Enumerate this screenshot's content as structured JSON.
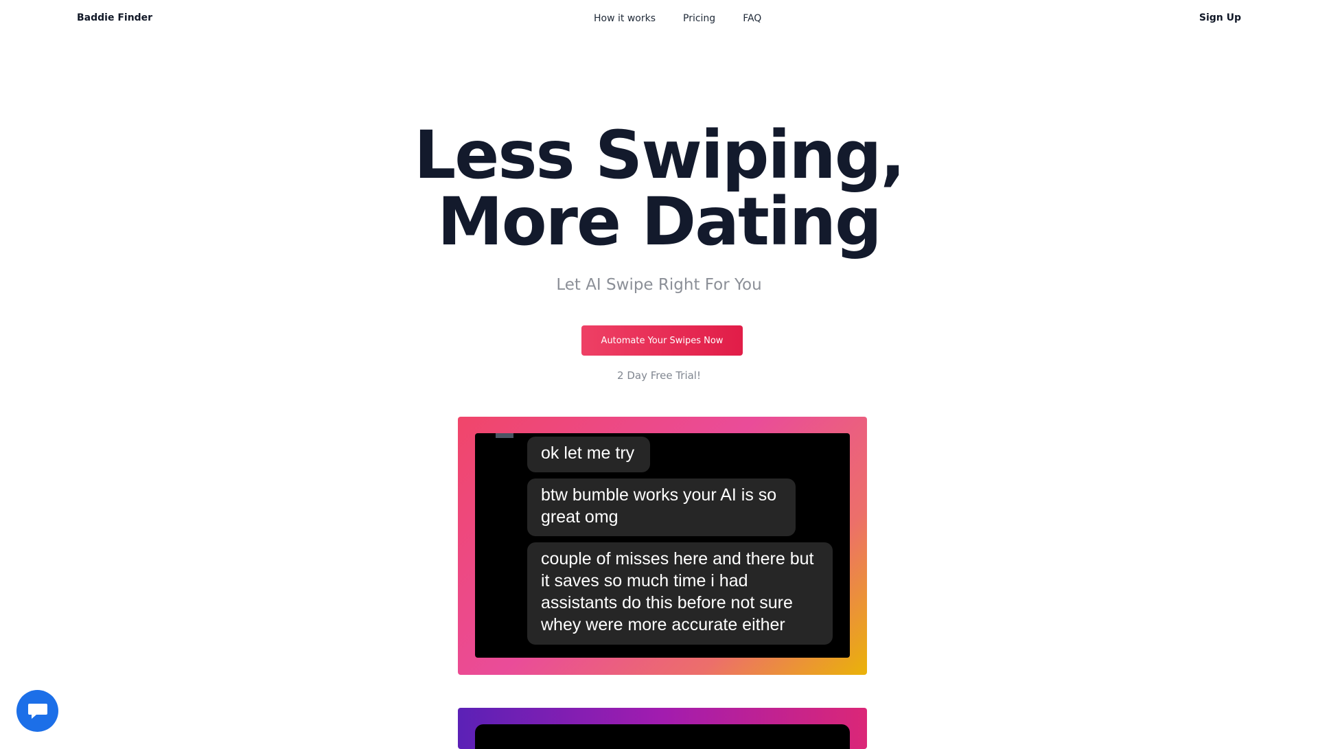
{
  "nav": {
    "brand": "Baddie Finder",
    "links": [
      "How it works",
      "Pricing",
      "FAQ"
    ],
    "signup": "Sign Up"
  },
  "hero": {
    "title_line1": "Less Swiping,",
    "title_line2": "More Dating",
    "subtitle": "Let AI Swipe Right For You",
    "cta": "Automate Your Swipes Now",
    "trial": "2 Day Free Trial!"
  },
  "testimonial": {
    "messages": [
      "ok let me try",
      "btw bumble works your AI is so great omg",
      "couple of misses here and there but it saves so much time i had assistants do this before not sure whey were more accurate either"
    ]
  },
  "widget": {
    "icon": "chat-bubble-icon"
  },
  "colors": {
    "accent": "#e11d48",
    "widget": "#1c6fe8",
    "title": "#131a2c"
  }
}
